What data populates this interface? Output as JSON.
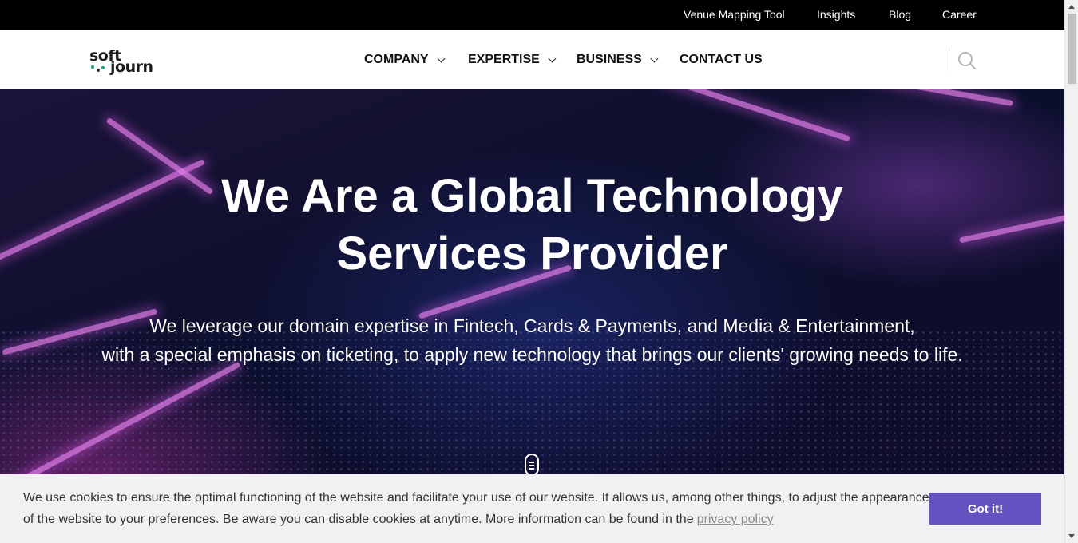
{
  "topbar": {
    "links": [
      "Venue Mapping Tool",
      "Insights",
      "Blog",
      "Career"
    ]
  },
  "header": {
    "logo": {
      "line1": "soft",
      "line2": "journ",
      "dot_color": "#1aa364"
    },
    "nav": [
      {
        "label": "COMPANY",
        "has_dropdown": true
      },
      {
        "label": "EXPERTISE",
        "has_dropdown": true
      },
      {
        "label": "BUSINESS",
        "has_dropdown": true
      },
      {
        "label": "CONTACT US",
        "has_dropdown": false
      }
    ],
    "search_icon": "search-icon"
  },
  "hero": {
    "title_line1": "We Are a Global Technology",
    "title_line2": "Services Provider",
    "subtitle_line1": "We leverage our domain expertise in Fintech, Cards & Payments, and Media & Entertainment,",
    "subtitle_line2": "with a special emphasis on ticketing, to apply new technology that brings our clients' growing needs to life.",
    "scroll_icon": "mouse-scroll-icon"
  },
  "cookie_banner": {
    "text_line1": "We use cookies to ensure the optimal functioning of the website and facilitate your use of our website. It allows us, among other things, to adjust the appearance",
    "text_line2": "of the website to your preferences. Be aware you can disable cookies at anytime. More information can be found in the",
    "link_label": "privacy policy",
    "button_label": "Got it!",
    "button_color": "#6353c0"
  },
  "colors": {
    "topbar_bg": "#000000",
    "accent": "#6353c0"
  }
}
